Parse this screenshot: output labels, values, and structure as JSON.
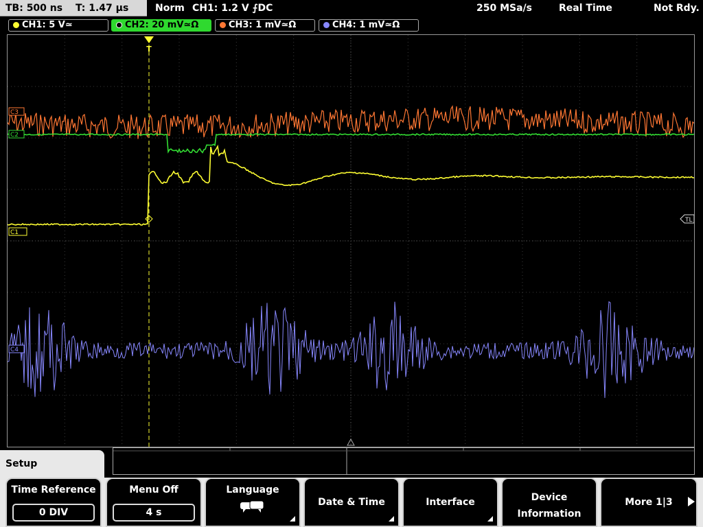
{
  "top": {
    "timebase": "TB: 500 ns",
    "trigger_time": "T: 1.47 µs",
    "mode": "Norm",
    "trigger_info": "CH1: 1.2 V ⨍DC",
    "sample_rate": "250 MSa/s",
    "acq_mode": "Real Time",
    "status": "Not Rdy."
  },
  "channels": [
    {
      "label": "CH1: 5 V≃",
      "color": "#ffff33",
      "active": false
    },
    {
      "label": "CH2: 20 mV≃Ω",
      "color": "#33dd33",
      "active": true
    },
    {
      "label": "CH3: 1 mV≃Ω",
      "color": "#ff7733",
      "active": false
    },
    {
      "label": "CH4: 1 mV≃Ω",
      "color": "#8888ff",
      "active": false
    }
  ],
  "markers": {
    "c1": "C1",
    "c2": "C2",
    "c3": "C3",
    "c4": "C4",
    "trigger_level": "TL",
    "trigger_marker": "T"
  },
  "menu": {
    "title": "Setup",
    "softkeys": [
      {
        "label": "Time Reference",
        "value": "0 DIV"
      },
      {
        "label": "Menu Off",
        "value": "4 s"
      },
      {
        "label": "Language",
        "icon": "speech-bubble-icon"
      },
      {
        "label": "Date & Time"
      },
      {
        "label": "Interface"
      },
      {
        "label": "Device",
        "label2": "Information"
      },
      {
        "label": "More 1|3"
      }
    ]
  }
}
